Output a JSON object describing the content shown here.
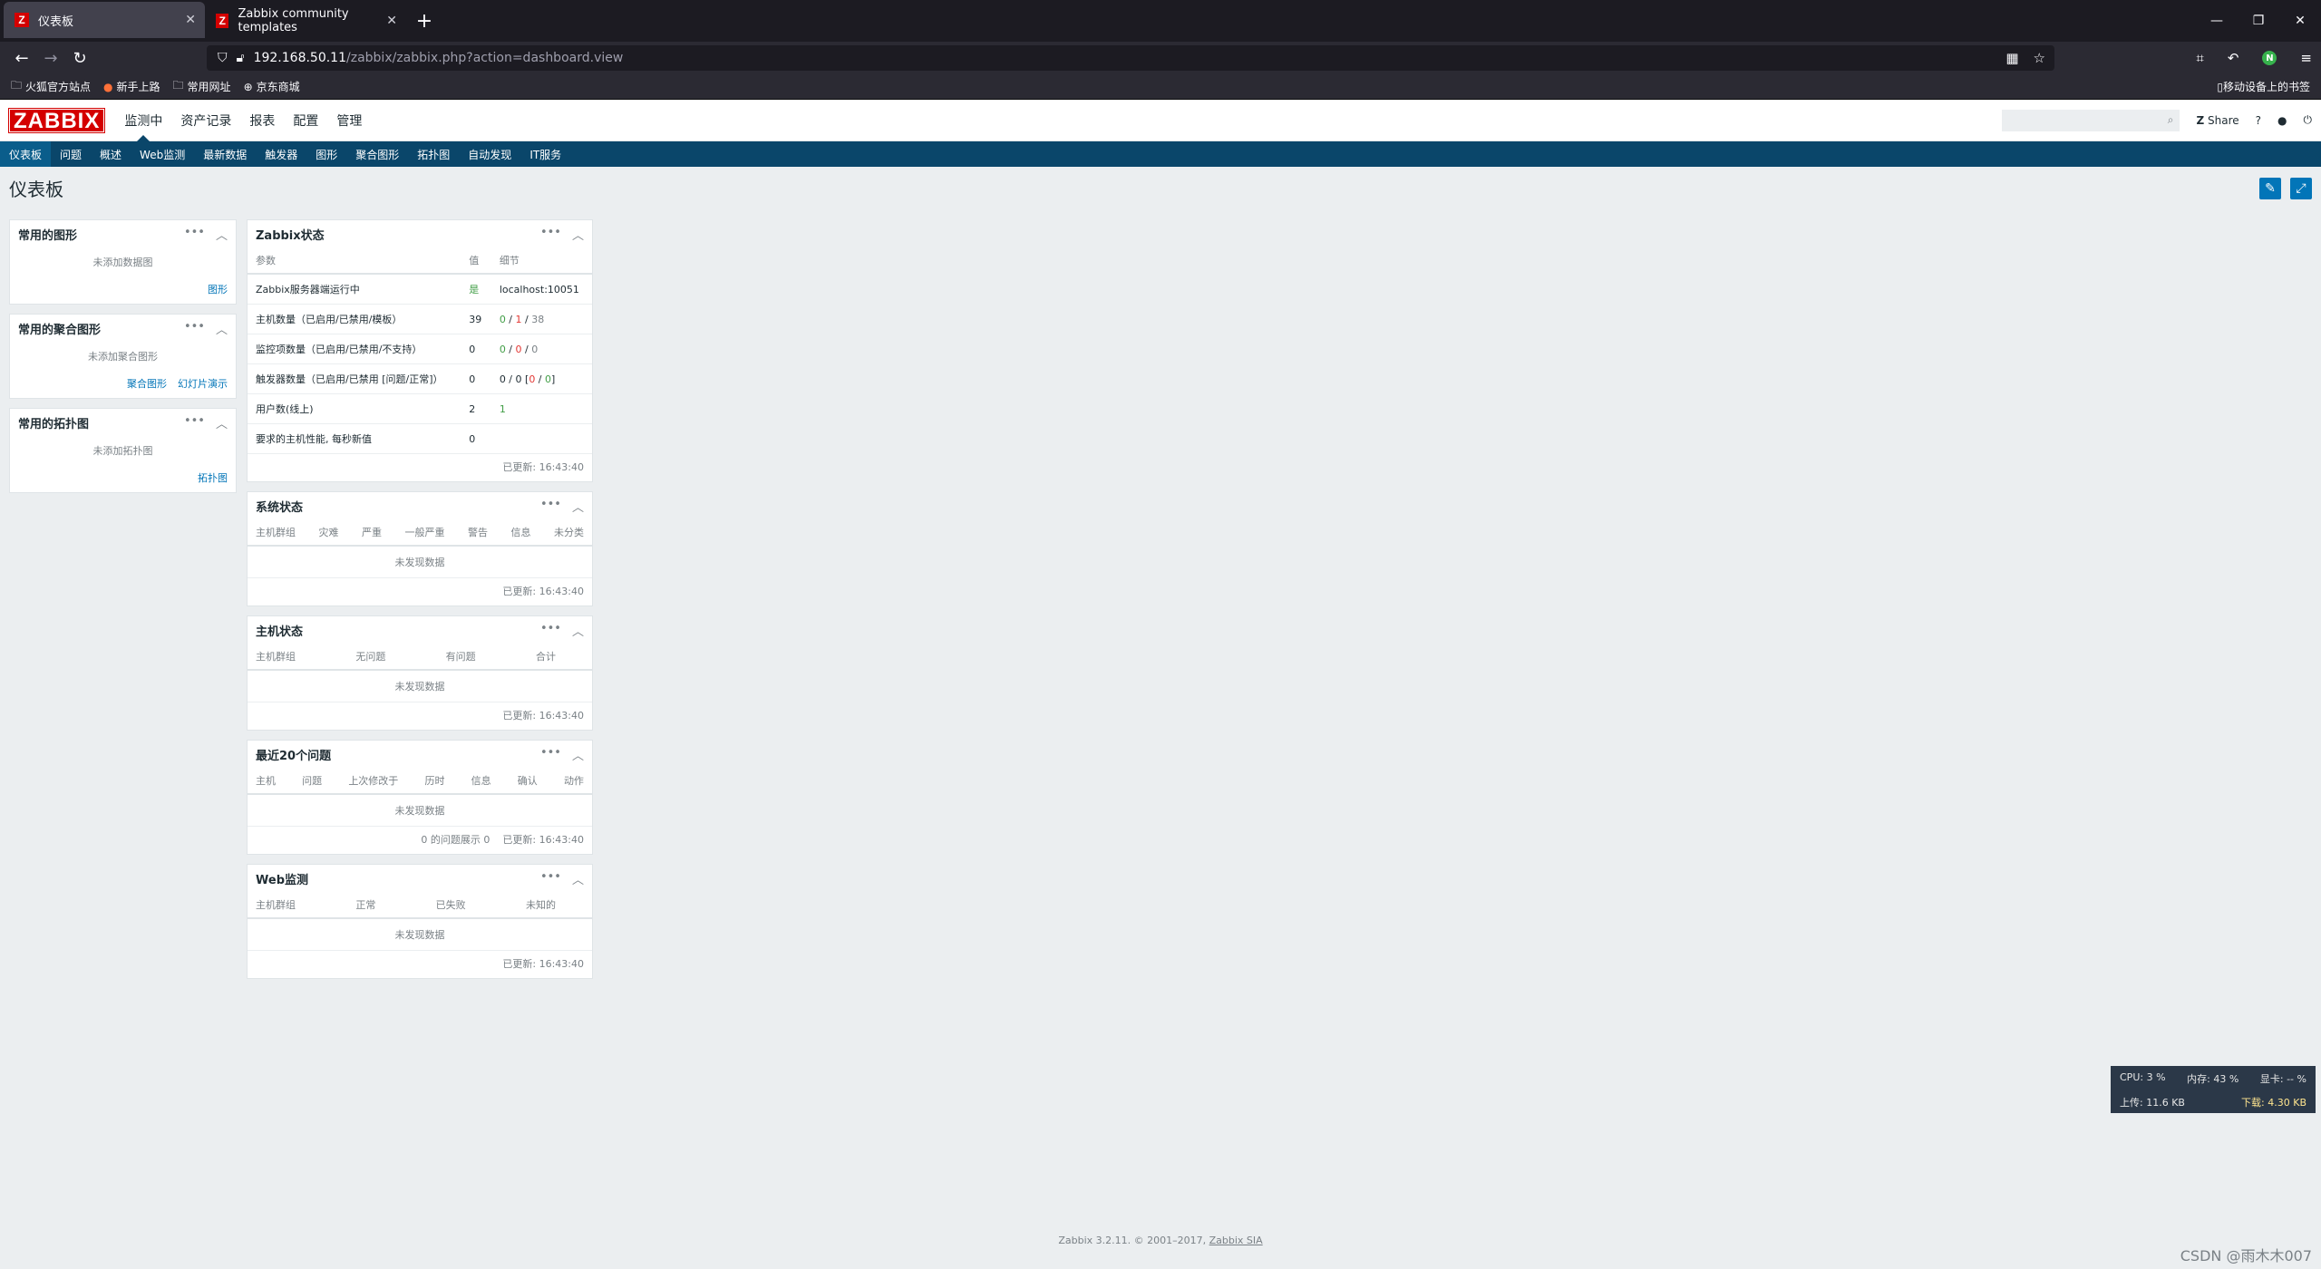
{
  "browser": {
    "tabs": [
      {
        "label": "仪表板",
        "active": true
      },
      {
        "label": "Zabbix community templates",
        "active": false
      }
    ],
    "url_host": "192.168.50.11",
    "url_path": "/zabbix/zabbix.php?action=dashboard.view",
    "bookmarks": [
      "火狐官方站点",
      "新手上路",
      "常用网址",
      "京东商城"
    ],
    "mobile_bookmarks": "移动设备上的书签"
  },
  "zabbix": {
    "logo": "ZABBIX",
    "top_menu": [
      "监测中",
      "资产记录",
      "报表",
      "配置",
      "管理"
    ],
    "share_label": "Share",
    "help_label": "?",
    "sub_menu": [
      "仪表板",
      "问题",
      "概述",
      "Web监测",
      "最新数据",
      "触发器",
      "图形",
      "聚合图形",
      "拓扑图",
      "自动发现",
      "IT服务"
    ],
    "page_title": "仪表板"
  },
  "widgets": {
    "fav_graphs": {
      "title": "常用的图形",
      "empty": "未添加数据图",
      "link": "图形"
    },
    "fav_screens": {
      "title": "常用的聚合图形",
      "empty": "未添加聚合图形",
      "link1": "聚合图形",
      "link2": "幻灯片演示"
    },
    "fav_maps": {
      "title": "常用的拓扑图",
      "empty": "未添加拓扑图",
      "link": "拓扑图"
    },
    "zabbix_status": {
      "title": "Zabbix状态",
      "headers": [
        "参数",
        "值",
        "细节"
      ],
      "rows": [
        {
          "param": "Zabbix服务器端运行中",
          "value": "是",
          "detail": "localhost:10051"
        },
        {
          "param": "主机数量（已启用/已禁用/模板）",
          "value": "39",
          "d1": "0",
          "d2": "1",
          "d3": "38"
        },
        {
          "param": "监控项数量（已启用/已禁用/不支持）",
          "value": "0",
          "d1": "0",
          "d2": "0",
          "d3": "0"
        },
        {
          "param": "触发器数量（已启用/已禁用 [问题/正常]）",
          "value": "0",
          "d1": "0",
          "d2": "0",
          "d3": "0",
          "d4": "0"
        },
        {
          "param": "用户数(线上)",
          "value": "2",
          "detail": "1"
        },
        {
          "param": "要求的主机性能, 每秒新值",
          "value": "0",
          "detail": ""
        }
      ],
      "updated": "已更新: 16:43:40"
    },
    "system_status": {
      "title": "系统状态",
      "headers": [
        "主机群组",
        "灾难",
        "严重",
        "一般严重",
        "警告",
        "信息",
        "未分类"
      ],
      "empty": "未发现数据",
      "updated": "已更新: 16:43:40"
    },
    "host_status": {
      "title": "主机状态",
      "headers": [
        "主机群组",
        "无问题",
        "有问题",
        "合计"
      ],
      "empty": "未发现数据",
      "updated": "已更新: 16:43:40"
    },
    "last_issues": {
      "title": "最近20个问题",
      "headers": [
        "主机",
        "问题",
        "上次修改于",
        "历时",
        "信息",
        "确认",
        "动作"
      ],
      "empty": "未发现数据",
      "shown": "0 的问题展示 0",
      "updated": "已更新: 16:43:40"
    },
    "web_monitoring": {
      "title": "Web监测",
      "headers": [
        "主机群组",
        "正常",
        "已失败",
        "未知的"
      ],
      "empty": "未发现数据",
      "updated": "已更新: 16:43:40"
    }
  },
  "footer": {
    "text": "Zabbix 3.2.11. © 2001–2017,",
    "link": "Zabbix SIA"
  },
  "watermark": "CSDN @雨木木007",
  "netmon": {
    "cpu": "CPU: 3 %",
    "mem": "内存: 43 %",
    "gpu": "显卡: -- %",
    "up": "上传: 11.6 KB",
    "down": "下载: 4.30 KB"
  }
}
